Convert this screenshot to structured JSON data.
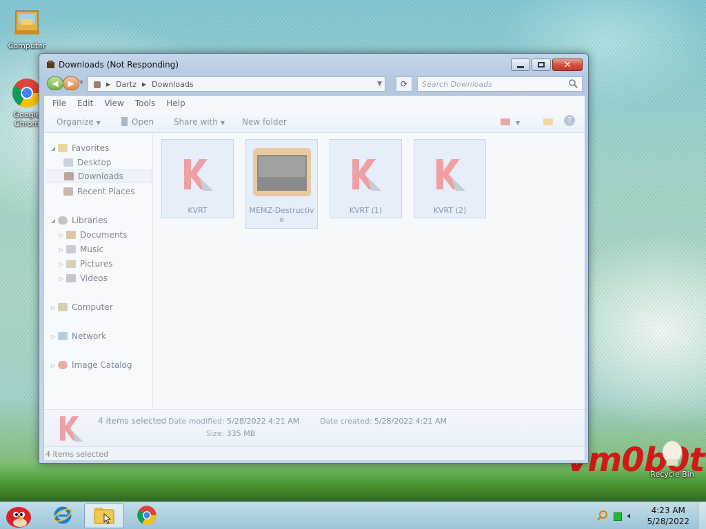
{
  "desktop": {
    "icons": [
      {
        "label": "Computer",
        "icon": "computer-icon"
      },
      {
        "label": "Google Chrom",
        "icon": "chrome-icon"
      },
      {
        "label": "Recycle Bin",
        "icon": "recycle-bin-icon"
      }
    ],
    "watermark": "vm0b0t"
  },
  "window": {
    "title": "Downloads (Not Responding)",
    "address": {
      "crumbs": [
        "Dartz",
        "Downloads"
      ]
    },
    "search_placeholder": "Search Downloads",
    "menu": [
      "File",
      "Edit",
      "View",
      "Tools",
      "Help"
    ],
    "commands": {
      "organize": "Organize",
      "open": "Open",
      "share_with": "Share with",
      "new_folder": "New folder"
    },
    "nav": {
      "favorites": "Favorites",
      "desktop": "Desktop",
      "downloads": "Downloads",
      "recent_places": "Recent Places",
      "libraries": "Libraries",
      "documents": "Documents",
      "music": "Music",
      "pictures": "Pictures",
      "videos": "Videos",
      "computer": "Computer",
      "network": "Network",
      "image_catalog": "Image Catalog"
    },
    "files": [
      {
        "name": "KVRT",
        "icon": "kaspersky-icon"
      },
      {
        "name": "MEMZ-Destructive",
        "icon": "memz-icon"
      },
      {
        "name": "KVRT (1)",
        "icon": "kaspersky-icon"
      },
      {
        "name": "KVRT (2)",
        "icon": "kaspersky-icon"
      }
    ],
    "details": {
      "selected": "4 items selected",
      "modified_label": "Date modified:",
      "modified_value": "5/28/2022 4:21 AM",
      "created_label": "Date created:",
      "created_value": "5/28/2022 4:21 AM",
      "size_label": "Size:",
      "size_value": "335 MB"
    },
    "status": "4 items selected"
  },
  "taskbar": {
    "apps": [
      "angry-birds-icon",
      "internet-explorer-icon",
      "explorer-folder-icon",
      "chrome-icon"
    ],
    "time": "4:23 AM",
    "date": "5/28/2022"
  },
  "colors": {
    "kaspersky_red": "#e0262e",
    "close_red": "#c23a27"
  }
}
